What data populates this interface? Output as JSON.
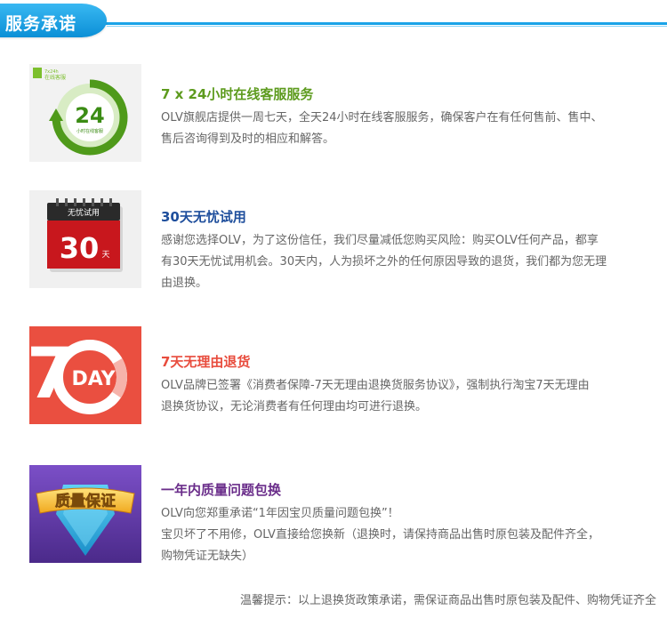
{
  "header": {
    "title": "服务承诺"
  },
  "sections": [
    {
      "icon_label": "24",
      "icon_sub": "小时在线客服",
      "icon_logo_text": "在线客服",
      "title": "7 x 24小时在线客服服务",
      "desc_lines": [
        "OLV旗舰店提供一周七天，全天24小时在线客服服务，确保客户在有任何售前、售中、",
        "售后咨询得到及时的相应和解答。"
      ]
    },
    {
      "icon_label": "无忧试用",
      "icon_number": "30",
      "icon_unit": "天",
      "title": "30天无忧试用",
      "desc_lines": [
        "感谢您选择OLV，为了这份信任，我们尽量减低您购买风险：购买OLV任何产品，都享",
        "有30天无忧试用机会。30天内，人为损坏之外的任何原因导致的退货，我们都为您无理",
        "由退换。"
      ]
    },
    {
      "icon_number": "7",
      "icon_label": "DAY",
      "title": "7天无理由退货",
      "desc_lines": [
        "OLV品牌已签署《消费者保障-7天无理由退换货服务协议》，强制执行淘宝7天无理由",
        "退换货协议，无论消费者有任何理由均可进行退换。"
      ]
    },
    {
      "icon_label": "质量保证",
      "title": "一年内质量问题包换",
      "desc_lines": [
        "OLV向您郑重承诺“1年因宝贝质量问题包换”！",
        "宝贝坏了不用修，OLV直接给您换新（退换时，请保持商品出售时原包装及配件齐全，",
        "购物凭证无缺失）"
      ]
    }
  ],
  "footer": {
    "note": "温馨提示：以上退换货政策承诺，需保证商品出售时原包装及配件、购物凭证齐全"
  }
}
